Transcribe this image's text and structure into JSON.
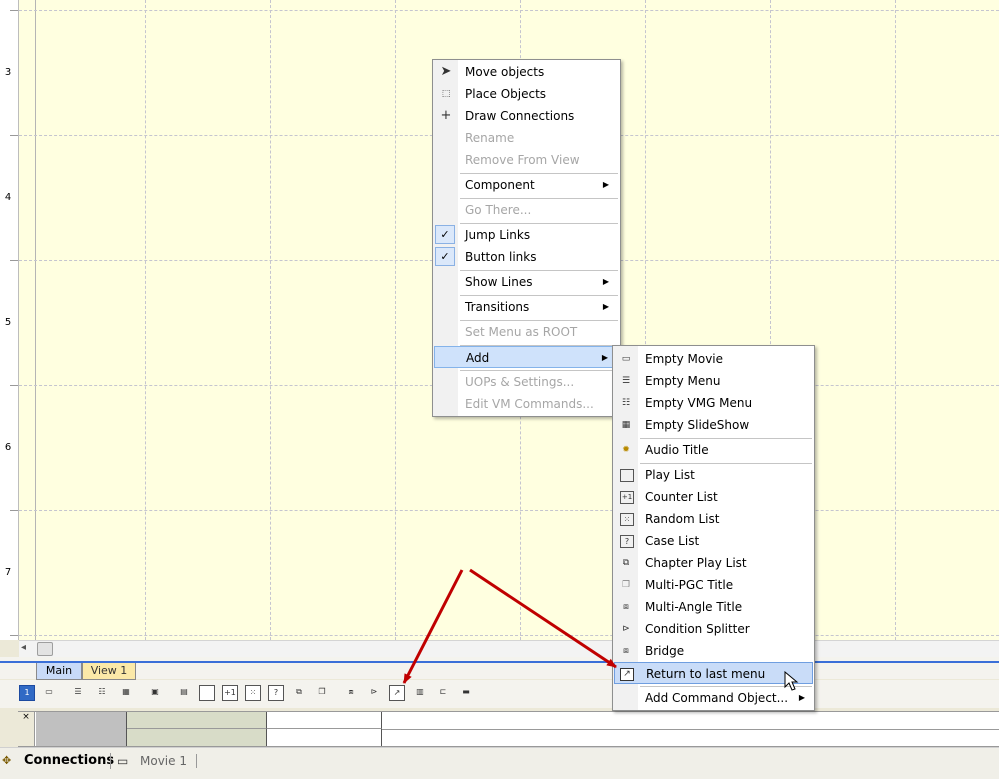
{
  "ruler": {
    "labels": [
      "3",
      "4",
      "5",
      "6",
      "7"
    ]
  },
  "view_tabs": {
    "main": "Main",
    "view1": "View 1"
  },
  "context_menu": {
    "move_objects": "Move objects",
    "place_objects": "Place Objects",
    "draw_connections": "Draw Connections",
    "rename": "Rename",
    "remove_from_view": "Remove From View",
    "component": "Component",
    "go_there": "Go There...",
    "jump_links": "Jump Links",
    "button_links": "Button links",
    "show_lines": "Show Lines",
    "transitions": "Transitions",
    "set_menu_as_root": "Set Menu as ROOT",
    "add": "Add",
    "uops_settings": "UOPs & Settings...",
    "edit_vm_commands": "Edit VM Commands...",
    "checkmark": "✓"
  },
  "add_submenu": {
    "empty_movie": "Empty Movie",
    "empty_menu": "Empty Menu",
    "empty_vmg_menu": "Empty VMG Menu",
    "empty_slideshow": "Empty SlideShow",
    "audio_title": "Audio Title",
    "play_list": "Play List",
    "counter_list": "Counter List",
    "random_list": "Random List",
    "case_list": "Case List",
    "chapter_play_list": "Chapter Play List",
    "multi_pgc_title": "Multi-PGC Title",
    "multi_angle_title": "Multi-Angle Title",
    "condition_splitter": "Condition Splitter",
    "bridge": "Bridge",
    "return_to_last_menu": "Return to last menu",
    "add_command_object": "Add Command Object..."
  },
  "toolbar": {
    "selected_page": "1"
  },
  "timeline": {
    "close": "×"
  },
  "bottom_tabs": {
    "connections": "Connections",
    "movie1": "Movie 1"
  },
  "colors": {
    "canvas": "#ffffe0",
    "annotation_arrow": "#c00000",
    "highlight": "#cfe2fb"
  }
}
